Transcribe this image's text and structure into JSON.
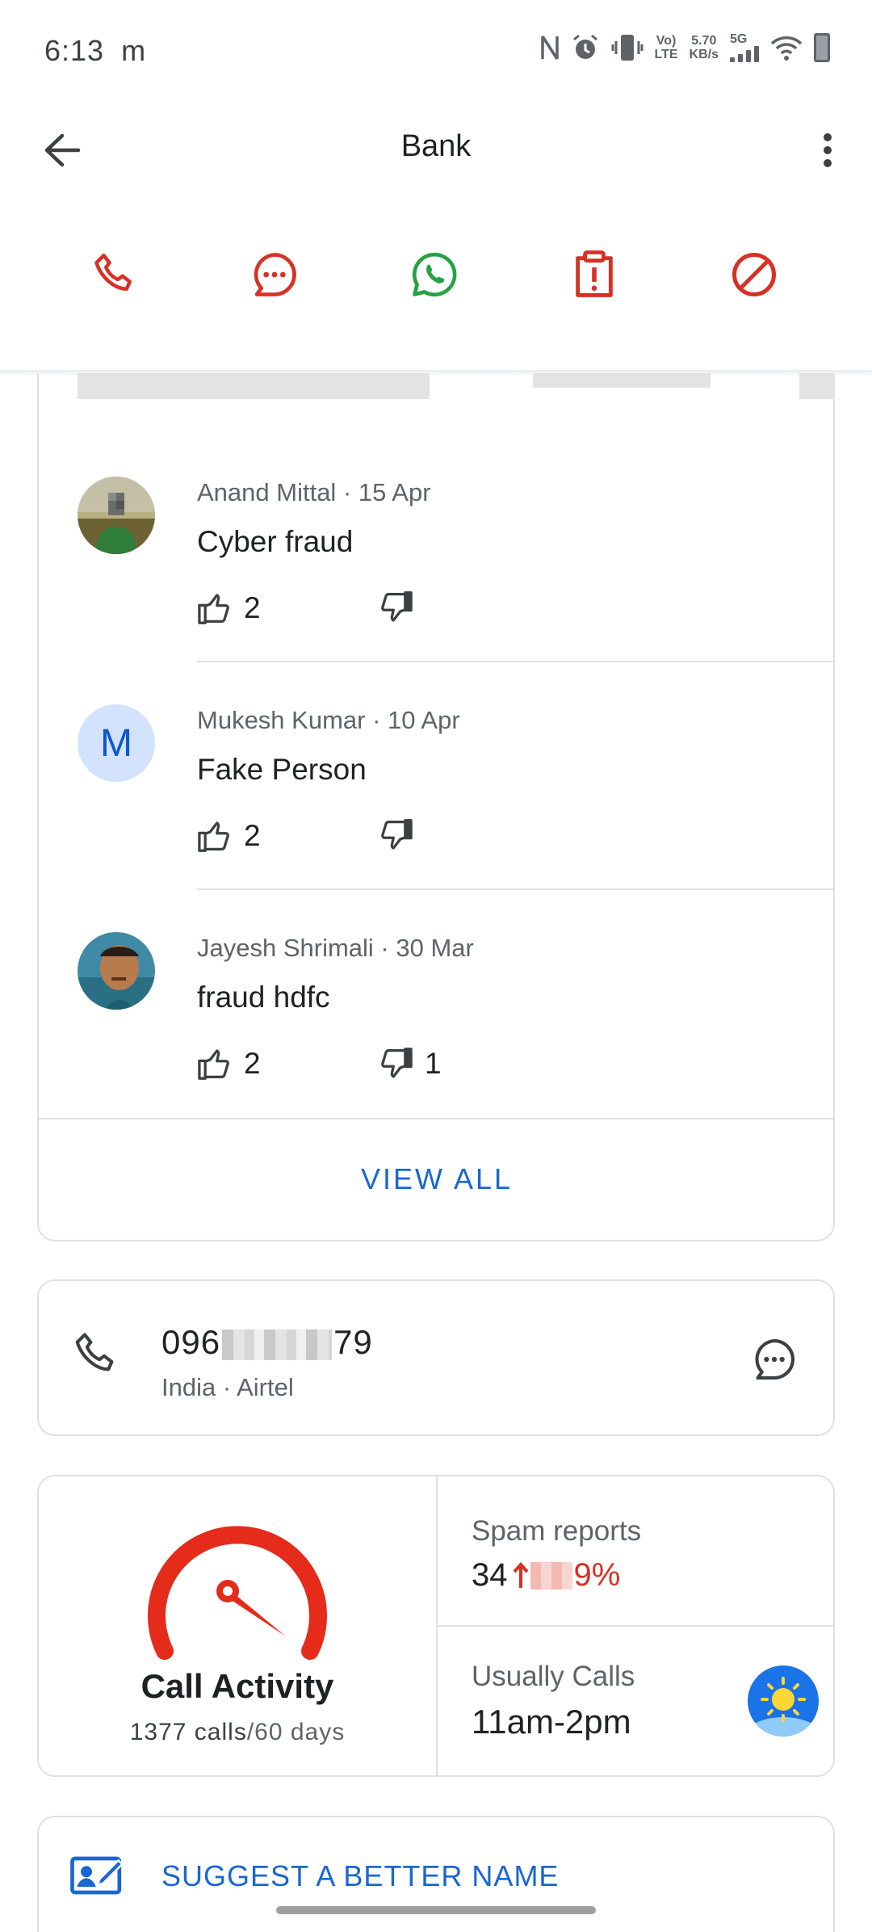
{
  "status_bar": {
    "time": "6:13",
    "notification_glyph": "m",
    "volte_top": "Vo)",
    "volte_bottom": "LTE",
    "speed_value": "5.70",
    "speed_unit": "KB/s",
    "network": "5G",
    "icons": [
      "nfc-icon",
      "alarm-icon",
      "vibrate-icon",
      "signal-icon",
      "wifi-icon",
      "battery-icon"
    ]
  },
  "app_bar": {
    "title": "Bank"
  },
  "actions": [
    {
      "name": "call",
      "icon": "phone-icon",
      "color": "#d93025"
    },
    {
      "name": "message",
      "icon": "message-icon",
      "color": "#d93025"
    },
    {
      "name": "whatsapp",
      "icon": "whatsapp-icon",
      "color": "#25a244"
    },
    {
      "name": "report",
      "icon": "report-icon",
      "color": "#d93025"
    },
    {
      "name": "block",
      "icon": "block-icon",
      "color": "#d93025"
    }
  ],
  "comments": [
    {
      "author": "Anand Mittal",
      "date": "15 Apr",
      "text": "Cyber fraud",
      "likes": "2",
      "dislikes": ""
    },
    {
      "author": "Mukesh Kumar",
      "date": "10 Apr",
      "text": "Fake Person",
      "likes": "2",
      "dislikes": "",
      "avatar_letter": "M"
    },
    {
      "author": "Jayesh Shrimali",
      "date": "30 Mar",
      "text": "fraud hdfc",
      "likes": "2",
      "dislikes": "1"
    }
  ],
  "view_all_label": "VIEW ALL",
  "number": {
    "prefix": "096",
    "suffix": "79",
    "location": "India",
    "carrier": "Airtel"
  },
  "stats": {
    "call_activity_title": "Call Activity",
    "calls_count": "1377 calls",
    "calls_period": "/60 days",
    "spam_label": "Spam reports",
    "spam_count": "34",
    "spam_change_suffix": "9%",
    "usually_calls_label": "Usually Calls",
    "usually_calls_value": "11am-2pm"
  },
  "suggest_label": "SUGGEST A BETTER NAME",
  "colors": {
    "accent_blue": "#1967d2",
    "alert_red": "#d93025",
    "whatsapp_green": "#25a244"
  }
}
